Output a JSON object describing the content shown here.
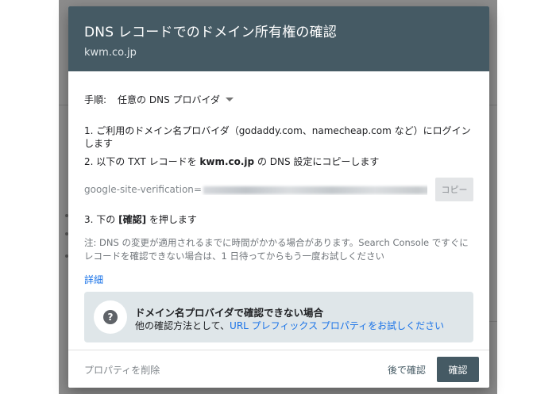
{
  "dialog": {
    "title": "DNS レコードでのドメイン所有権の確認",
    "domain": "kwm.co.jp"
  },
  "procedure": {
    "label": "手順:",
    "selected": "任意の DNS プロバイダ"
  },
  "steps": {
    "step1": "1. ご利用のドメイン名プロバイダ（godaddy.com、namecheap.com など）にログインします",
    "step2_prefix": "2. 以下の TXT レコードを ",
    "step2_domain": "kwm.co.jp",
    "step2_suffix": " の DNS 設定にコピーします",
    "step3_prefix": "3. 下の ",
    "step3_button": "[確認]",
    "step3_suffix": " を押します"
  },
  "verification": {
    "record_prefix": "google-site-verification=",
    "copy_label": "コピー"
  },
  "note": "注: DNS の変更が適用されるまでに時間がかかる場合があります。Search Console ですぐにレコードを確認できない場合は、1 日待ってからもう一度お試しください",
  "details_link": "詳細",
  "help_card": {
    "title": "ドメイン名プロバイダで確認できない場合",
    "text_prefix": "他の確認方法として、",
    "link": "URL プレフィックス プロパティをお試しください"
  },
  "footer": {
    "delete_label": "プロパティを削除",
    "later_label": "後で確認",
    "confirm_label": "確認"
  },
  "colors": {
    "header": "#455a64",
    "link": "#1a73e8",
    "card": "#dfe6e9"
  }
}
